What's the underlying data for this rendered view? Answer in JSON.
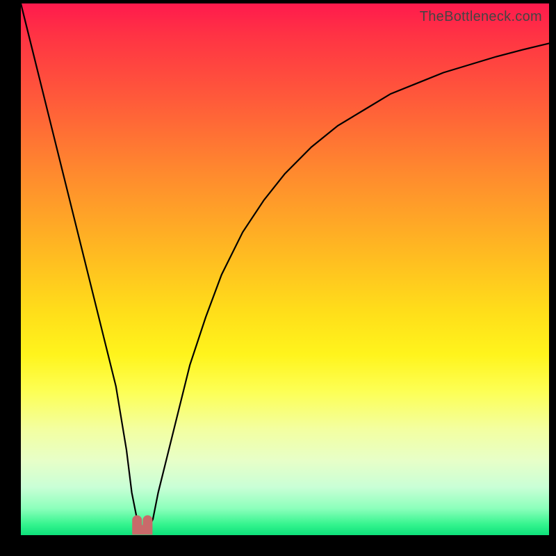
{
  "watermark": "TheBottleneck.com",
  "chart_data": {
    "type": "line",
    "title": "",
    "xlabel": "",
    "ylabel": "",
    "xlim": [
      0,
      100
    ],
    "ylim": [
      0,
      100
    ],
    "series": [
      {
        "name": "bottleneck-curve",
        "x": [
          0,
          2,
          4,
          6,
          8,
          10,
          12,
          14,
          16,
          18,
          20,
          21,
          22,
          23,
          24,
          25,
          26,
          28,
          30,
          32,
          35,
          38,
          42,
          46,
          50,
          55,
          60,
          65,
          70,
          75,
          80,
          85,
          90,
          95,
          100
        ],
        "values": [
          100,
          92,
          84,
          76,
          68,
          60,
          52,
          44,
          36,
          28,
          16,
          8,
          3,
          1,
          1,
          3,
          8,
          16,
          24,
          32,
          41,
          49,
          57,
          63,
          68,
          73,
          77,
          80,
          83,
          85,
          87,
          88.5,
          90,
          91.3,
          92.5
        ]
      }
    ],
    "annotations": [
      {
        "name": "minimum-marker",
        "x_range": [
          22,
          24
        ],
        "y": 1
      }
    ],
    "background_gradient": {
      "top": "#ff1a4d",
      "bottom": "#0de07a"
    }
  }
}
